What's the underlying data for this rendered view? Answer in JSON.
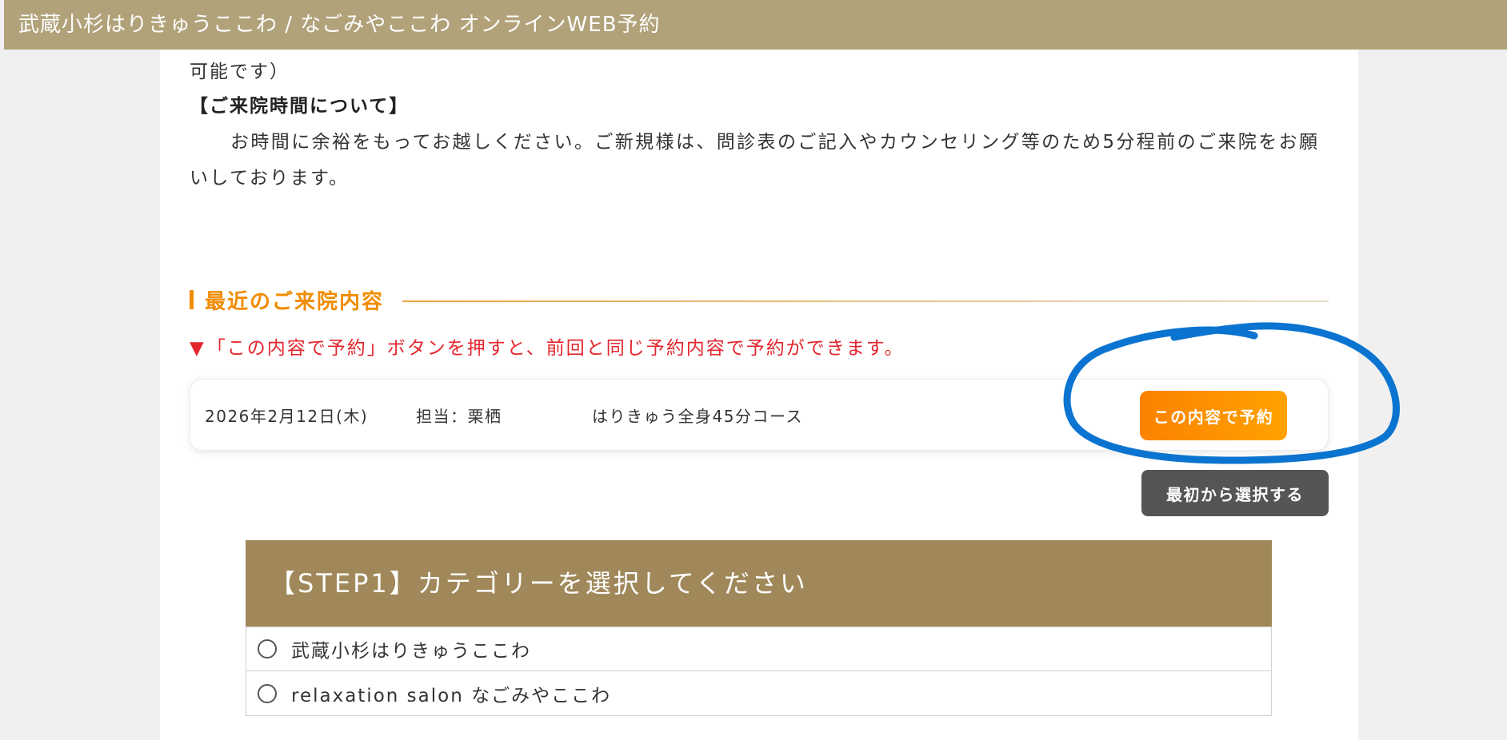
{
  "header": {
    "title": "武蔵小杉はりきゅうここわ / なごみやここわ オンラインWEB予約"
  },
  "notice": {
    "tail_text": "可能です）",
    "heading": "【ご来院時間について】",
    "body": "お時間に余裕をもってお越しください。ご新規様は、問診表のご記入やカウンセリング等のため5分程前のご来院をお願いしております。"
  },
  "recent": {
    "section_title": "最近のご来院内容",
    "hint_marker": "▼",
    "hint": "「この内容で予約」ボタンを押すと、前回と同じ予約内容で予約ができます。",
    "visit": {
      "date": "2026年2月12日(木)",
      "staff": "担当：栗栖",
      "course": "はりきゅう全身45分コース",
      "rebook_label": "この内容で予約"
    },
    "restart_label": "最初から選択する"
  },
  "step1": {
    "title": "【STEP1】カテゴリーを選択してください",
    "options": [
      {
        "label": "武蔵小杉はりきゅうここわ"
      },
      {
        "label": "relaxation salon なごみやここわ"
      }
    ]
  },
  "colors": {
    "topbar": "#b1a27a",
    "accent_orange": "#f08c00",
    "hint_red": "#e3262e",
    "step_header": "#a0885a",
    "annotation_blue": "#0b74d0"
  }
}
